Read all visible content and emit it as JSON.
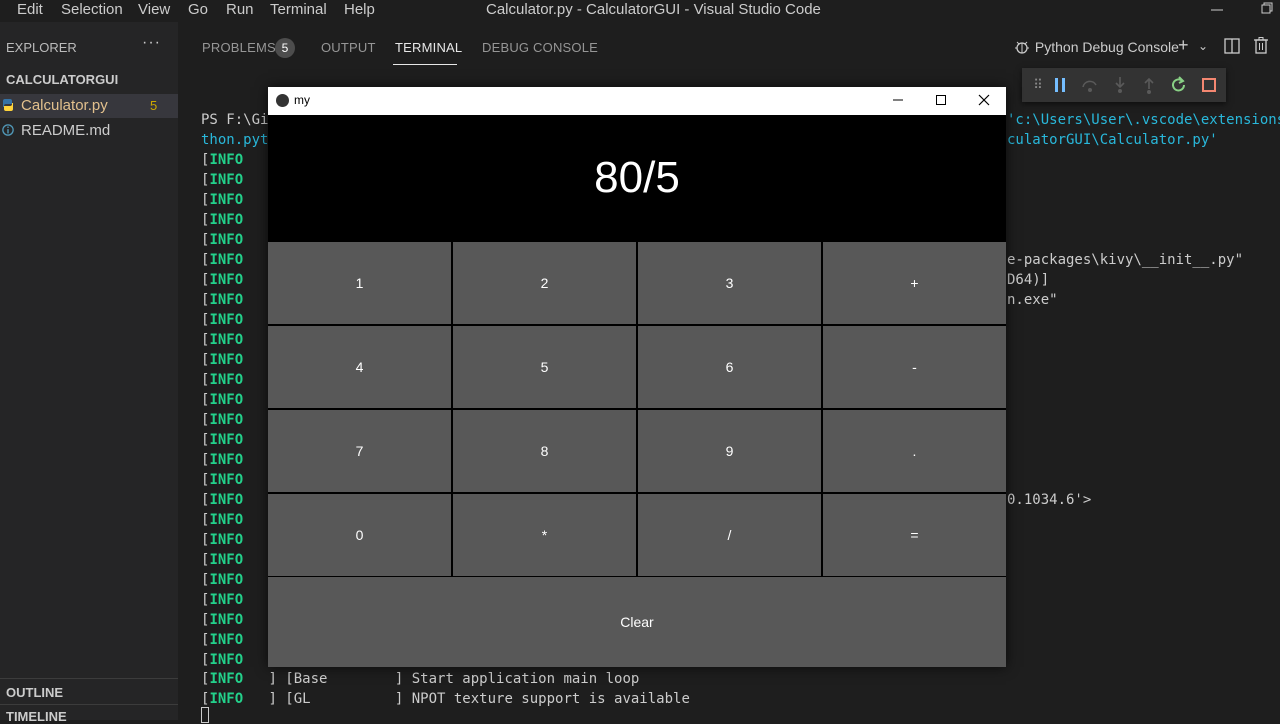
{
  "menu": [
    "Edit",
    "Selection",
    "View",
    "Go",
    "Run",
    "Terminal",
    "Help"
  ],
  "window": {
    "title": "Calculator.py - CalculatorGUI - Visual Studio Code"
  },
  "sidebar": {
    "header": "EXPLORER",
    "more": "···",
    "folder": "CALCULATORGUI",
    "files": [
      {
        "name": "Calculator.py",
        "count": "5",
        "icon": "python-file-icon",
        "color": "#e2c08d"
      },
      {
        "name": "README.md",
        "icon": "info-icon",
        "color": "#cccccc"
      }
    ],
    "outline": "OUTLINE",
    "timeline": "TIMELINE"
  },
  "panel": {
    "tabs": [
      "PROBLEMS",
      "OUTPUT",
      "TERMINAL",
      "DEBUG CONSOLE"
    ],
    "problems_count": "5",
    "active_tab": "TERMINAL",
    "debug_console": "Python Debug Console"
  },
  "terminal": {
    "prompt": "PS F:\\Gi",
    "right_path1": "'c:\\Users\\User\\.vscode\\extensions\\",
    "left_frag2": "thon.pyt",
    "right_path2": "culatorGUI\\Calculator.py'",
    "info_tag": "INFO",
    "right_frag_kivy": "e-packages\\kivy\\__init__.py\"",
    "right_frag_d64": "D64)]",
    "right_frag_exe": "n.exe\"",
    "right_frag_ver": "0.1034.6'>",
    "line_base": "   ] [Base        ] Start application main loop",
    "line_gl": "   ] [GL          ] NPOT texture support is available"
  },
  "kivy": {
    "title": "my",
    "display": "80/5",
    "buttons": [
      "1",
      "2",
      "3",
      "+",
      "4",
      "5",
      "6",
      "-",
      "7",
      "8",
      "9",
      ".",
      "0",
      "*",
      "/",
      "="
    ],
    "clear": "Clear"
  },
  "colors": {
    "info_green": "#23d18b",
    "path_cyan": "#29b8db",
    "problems_yellow": "#cca700",
    "button_gray": "#585858"
  }
}
